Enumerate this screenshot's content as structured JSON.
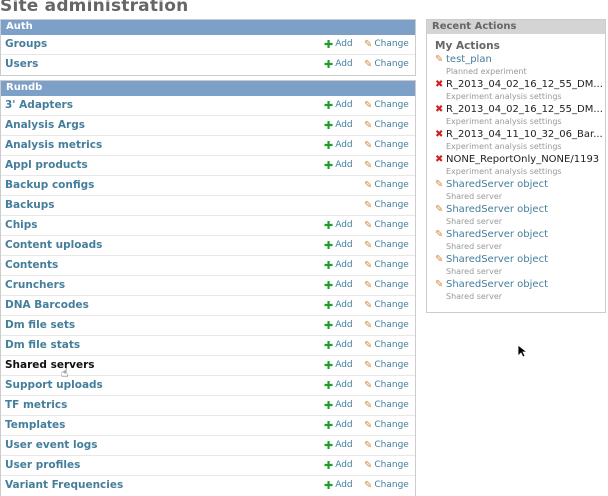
{
  "page_title": "Site administration",
  "modules": [
    {
      "header": "Auth",
      "rows": [
        {
          "name": "Groups",
          "add": true,
          "add_label": "Add",
          "change_label": "Change"
        },
        {
          "name": "Users",
          "add": true,
          "add_label": "Add",
          "change_label": "Change"
        }
      ]
    },
    {
      "header": "Rundb",
      "rows": [
        {
          "name": "3' Adapters",
          "add": true,
          "add_label": "Add",
          "change_label": "Change"
        },
        {
          "name": "Analysis Args",
          "add": true,
          "add_label": "Add",
          "change_label": "Change"
        },
        {
          "name": "Analysis metrics",
          "add": true,
          "add_label": "Add",
          "change_label": "Change"
        },
        {
          "name": "Appl products",
          "add": true,
          "add_label": "Add",
          "change_label": "Change"
        },
        {
          "name": "Backup configs",
          "add": false,
          "add_label": "",
          "change_label": "Change"
        },
        {
          "name": "Backups",
          "add": false,
          "add_label": "",
          "change_label": "Change"
        },
        {
          "name": "Chips",
          "add": true,
          "add_label": "Add",
          "change_label": "Change"
        },
        {
          "name": "Content uploads",
          "add": true,
          "add_label": "Add",
          "change_label": "Change"
        },
        {
          "name": "Contents",
          "add": true,
          "add_label": "Add",
          "change_label": "Change"
        },
        {
          "name": "Crunchers",
          "add": true,
          "add_label": "Add",
          "change_label": "Change"
        },
        {
          "name": "DNA Barcodes",
          "add": true,
          "add_label": "Add",
          "change_label": "Change"
        },
        {
          "name": "Dm file sets",
          "add": true,
          "add_label": "Add",
          "change_label": "Change"
        },
        {
          "name": "Dm file stats",
          "add": true,
          "add_label": "Add",
          "change_label": "Change"
        },
        {
          "name": "Shared servers",
          "add": true,
          "add_label": "Add",
          "change_label": "Change",
          "active": true
        },
        {
          "name": "Support uploads",
          "add": true,
          "add_label": "Add",
          "change_label": "Change"
        },
        {
          "name": "TF metrics",
          "add": true,
          "add_label": "Add",
          "change_label": "Change"
        },
        {
          "name": "Templates",
          "add": true,
          "add_label": "Add",
          "change_label": "Change"
        },
        {
          "name": "User event logs",
          "add": true,
          "add_label": "Add",
          "change_label": "Change"
        },
        {
          "name": "User profiles",
          "add": true,
          "add_label": "Add",
          "change_label": "Change"
        },
        {
          "name": "Variant Frequencies",
          "add": true,
          "add_label": "Add",
          "change_label": "Change"
        }
      ]
    }
  ],
  "recent": {
    "header": "Recent Actions",
    "subheader": "My Actions",
    "items": [
      {
        "icon": "pencil-icon",
        "title": "test_plan",
        "desc": "Planned experiment",
        "deleted": false
      },
      {
        "icon": "delete-icon",
        "title": "R_2013_04_02_16_12_55_DM...",
        "desc": "Experiment analysis settings",
        "deleted": true
      },
      {
        "icon": "delete-icon",
        "title": "R_2013_04_02_16_12_55_DM...",
        "desc": "Experiment analysis settings",
        "deleted": true
      },
      {
        "icon": "delete-icon",
        "title": "R_2013_04_11_10_32_06_Bar...",
        "desc": "Experiment analysis settings",
        "deleted": true
      },
      {
        "icon": "delete-icon",
        "title": "NONE_ReportOnly_NONE/1193",
        "desc": "Experiment analysis settings",
        "deleted": true
      },
      {
        "icon": "pencil-icon",
        "title": "SharedServer object",
        "desc": "Shared server",
        "deleted": false
      },
      {
        "icon": "pencil-icon",
        "title": "SharedServer object",
        "desc": "Shared server",
        "deleted": false
      },
      {
        "icon": "pencil-icon",
        "title": "SharedServer object",
        "desc": "Shared server",
        "deleted": false
      },
      {
        "icon": "pencil-icon",
        "title": "SharedServer object",
        "desc": "Shared server",
        "deleted": false
      },
      {
        "icon": "pencil-icon",
        "title": "SharedServer object",
        "desc": "Shared server",
        "deleted": false
      }
    ]
  }
}
